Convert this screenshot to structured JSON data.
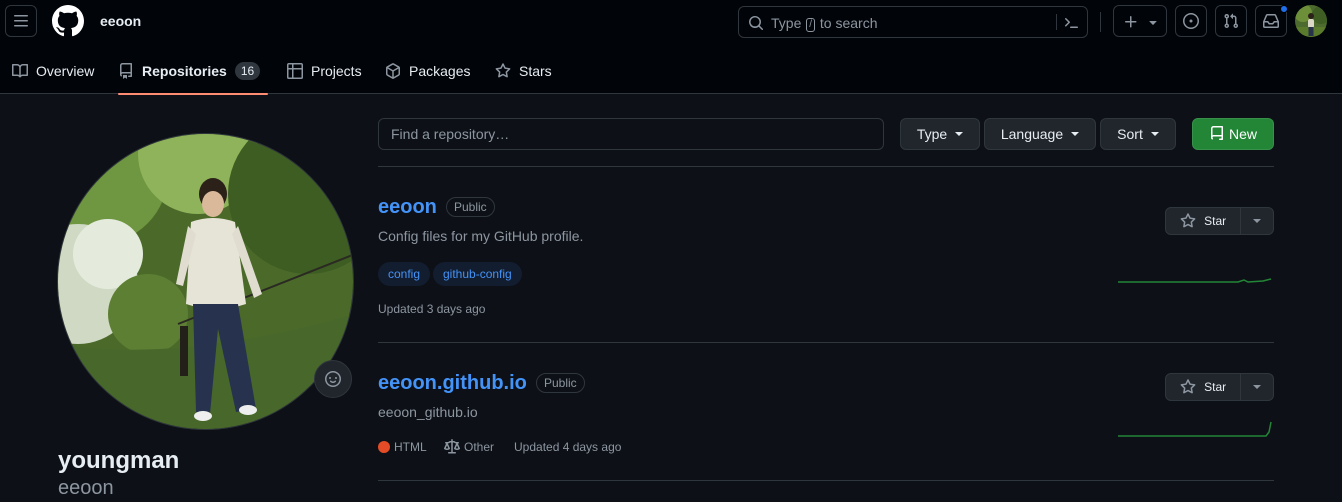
{
  "header": {
    "context_title": "eeoon",
    "search": {
      "prefix": "Type",
      "key": "/",
      "suffix": "to search"
    }
  },
  "tabs": [
    {
      "label": "Overview",
      "icon": "book-icon"
    },
    {
      "label": "Repositories",
      "icon": "repo-icon",
      "count": "16",
      "active": true
    },
    {
      "label": "Projects",
      "icon": "table-icon"
    },
    {
      "label": "Packages",
      "icon": "package-icon"
    },
    {
      "label": "Stars",
      "icon": "star-icon"
    }
  ],
  "profile": {
    "name": "youngman",
    "login": "eeoon"
  },
  "toolbar": {
    "find_placeholder": "Find a repository…",
    "type_label": "Type",
    "language_label": "Language",
    "sort_label": "Sort",
    "new_label": "New"
  },
  "repos": [
    {
      "name": "eeoon",
      "visibility": "Public",
      "description": "Config files for my GitHub profile.",
      "topics": [
        "config",
        "github-config"
      ],
      "updated": "Updated 3 days ago",
      "star_label": "Star"
    },
    {
      "name": "eeoon.github.io",
      "visibility": "Public",
      "description": "eeoon_github.io",
      "language": "HTML",
      "language_color": "#e34c26",
      "license": "Other",
      "updated": "Updated 4 days ago",
      "star_label": "Star"
    }
  ],
  "colors": {
    "accent": "#4493f8",
    "new_button": "#238636",
    "tab_underline": "#fd8c73",
    "sparkline": "#238636"
  }
}
